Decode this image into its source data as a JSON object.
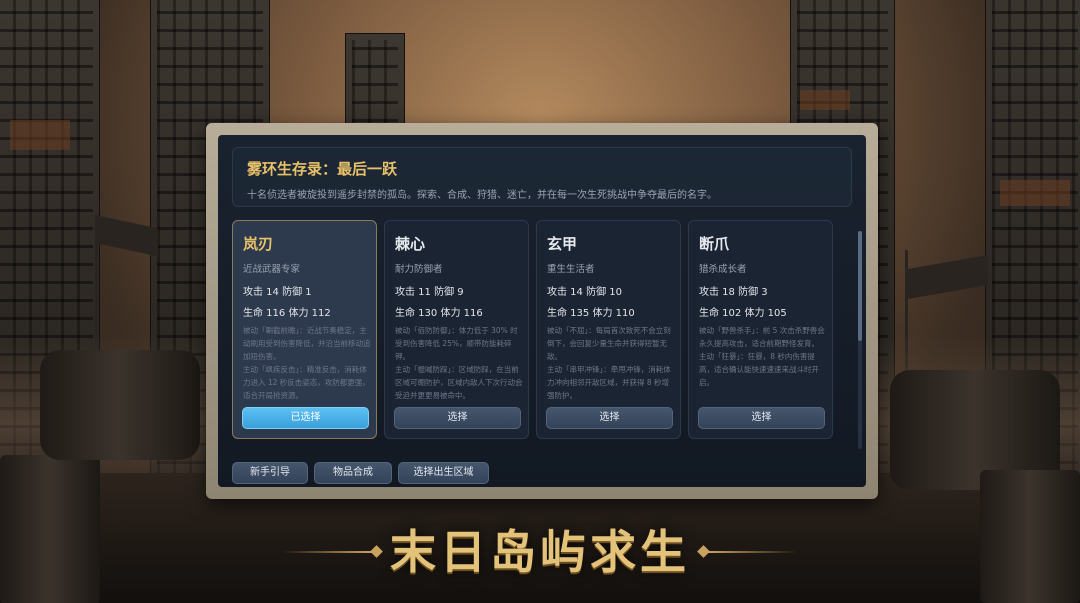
{
  "header": {
    "title": "雾环生存录：最后一跃",
    "subtitle": "十名侦选者被旋投到遥步封禁的孤岛。探索、合成、狩猎、迷亡，并在每一次生死挑战中争夺最后的名字。"
  },
  "characters": [
    {
      "name": "岚刃",
      "role": "近战武器专家",
      "attack_defense": "攻击 14 防御 1",
      "hp_stamina": "生命 116 体力 112",
      "passive": "被动「唰截前瞻」：近战节奏稳定，主动刷用受到伤害降低，并沿当前移动追加短伤害。",
      "active": "主动「飒疾反击」：精准反击，消耗体力进入 12 秒反击姿态，攻防都更强，适合开局抢资源。",
      "button": "已选择",
      "selected": true
    },
    {
      "name": "棘心",
      "role": "耐力防御者",
      "attack_defense": "攻击 11 防御 9",
      "hp_stamina": "生命 130 体力 116",
      "passive": "被动「佰防防御」：体力低于 30% 时受到伤害降低 25%，顺带防能耗碎钾。",
      "active": "主动「棍喊防踩」：区域防踩，在当前区域可绷防护，区域内敌人下次行动会受迫并更更易被命中。",
      "button": "选择",
      "selected": false
    },
    {
      "name": "玄甲",
      "role": "重生生活者",
      "attack_defense": "攻击 14 防御 10",
      "hp_stamina": "生命 135 体力 110",
      "passive": "被动「不屈」：每局首次致死不会立刻倒下，会回复少量生命并获得短暂无敌。",
      "active": "主动「串甲冲锋」：牵甩冲锋，消耗体力冲向相邻开敌区域，并获得 8 秒增强防护。",
      "button": "选择",
      "selected": false
    },
    {
      "name": "断爪",
      "role": "猎杀成长者",
      "attack_defense": "攻击 18 防御 3",
      "hp_stamina": "生命 102 体力 105",
      "passive": "被动「野兽杀手」：前 5 次击杀野兽会永久提高攻击，适合前期野怪发育。",
      "active": "主动「狂暴」：狂暴，8 秒内伤害提高，适合确认能快速速速来战斗时开启。",
      "button": "选择",
      "selected": false
    }
  ],
  "bottom_buttons": [
    "新手引导",
    "物品合成",
    "选择出生区域"
  ],
  "banner": {
    "title": "末日岛屿求生"
  },
  "colors": {
    "accent_gold": "#e8c169",
    "selected_button": "#4fb4ea",
    "panel_bg": "#19222f",
    "frame": "#b8ad99"
  }
}
